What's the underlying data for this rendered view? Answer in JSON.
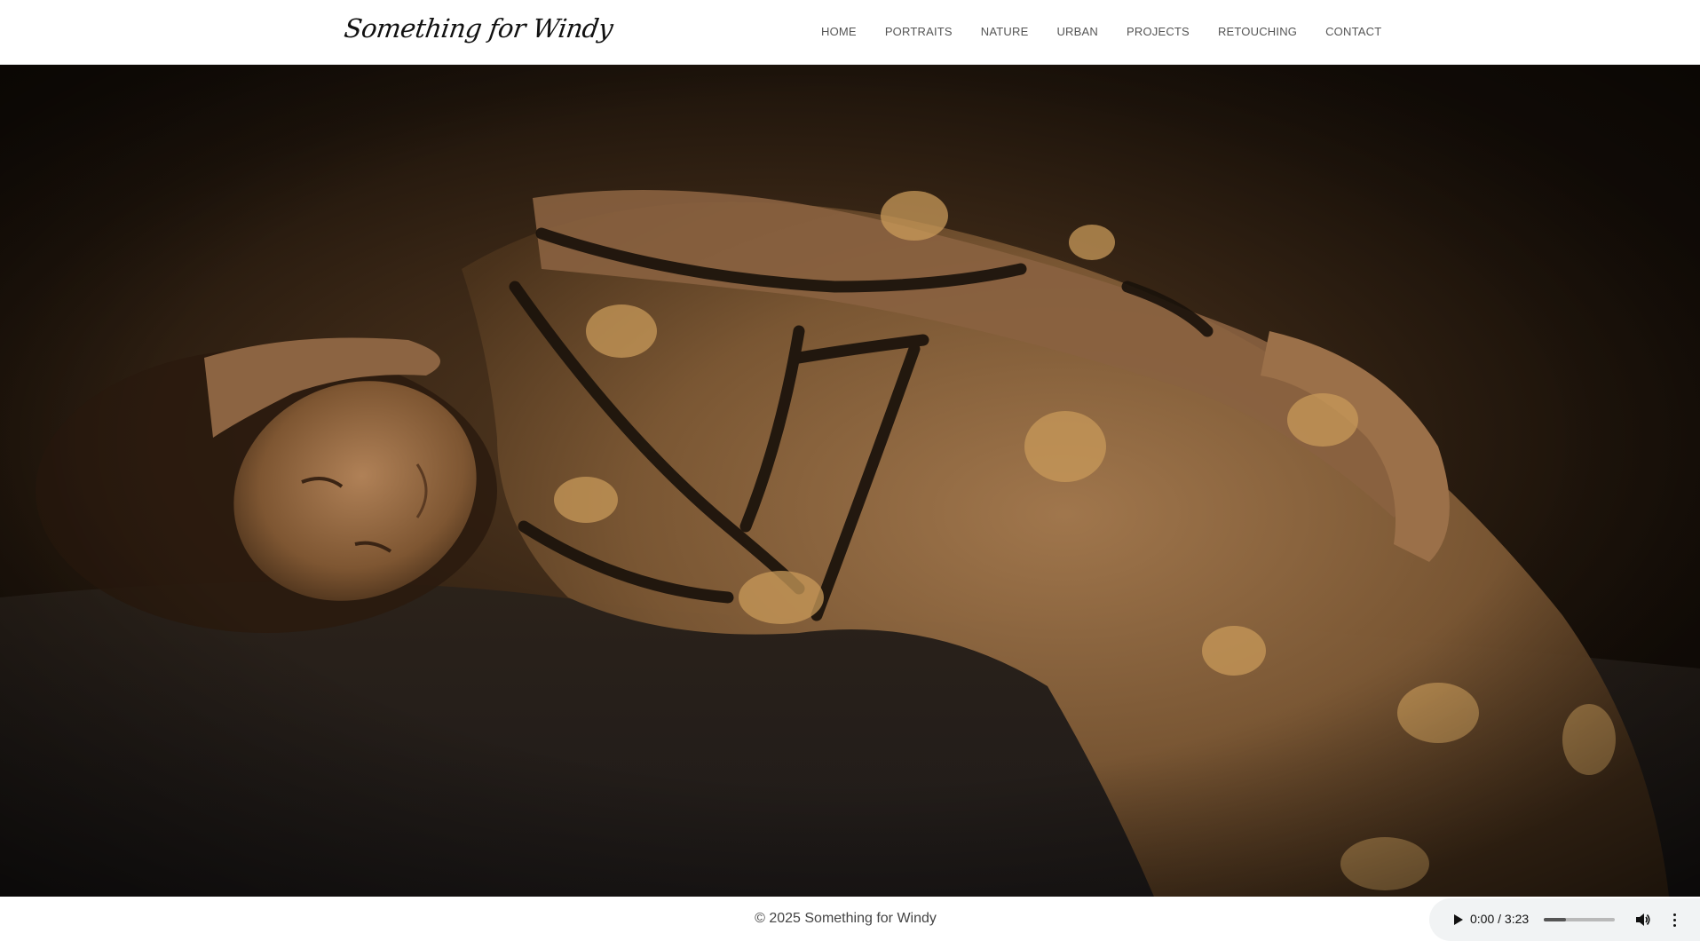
{
  "site": {
    "logo": "Something for Windy"
  },
  "nav": {
    "items": [
      {
        "label": "HOME"
      },
      {
        "label": "PORTRAITS"
      },
      {
        "label": "NATURE"
      },
      {
        "label": "URBAN"
      },
      {
        "label": "PROJECTS"
      },
      {
        "label": "RETOUCHING"
      },
      {
        "label": "CONTACT"
      }
    ]
  },
  "hero": {
    "colors": {
      "shadow": "#150e08",
      "warm": "#5a3e23",
      "skin": "#9a7048",
      "lace": "#c89a5a",
      "strap": "#1a120b",
      "sheet": "#2a2a2e"
    }
  },
  "footer": {
    "copyright": "© 2025 Something for Windy"
  },
  "audio": {
    "current_time": "0:00",
    "duration": "3:23",
    "time_display": "0:00 / 3:23",
    "volume_level": 0.3
  }
}
